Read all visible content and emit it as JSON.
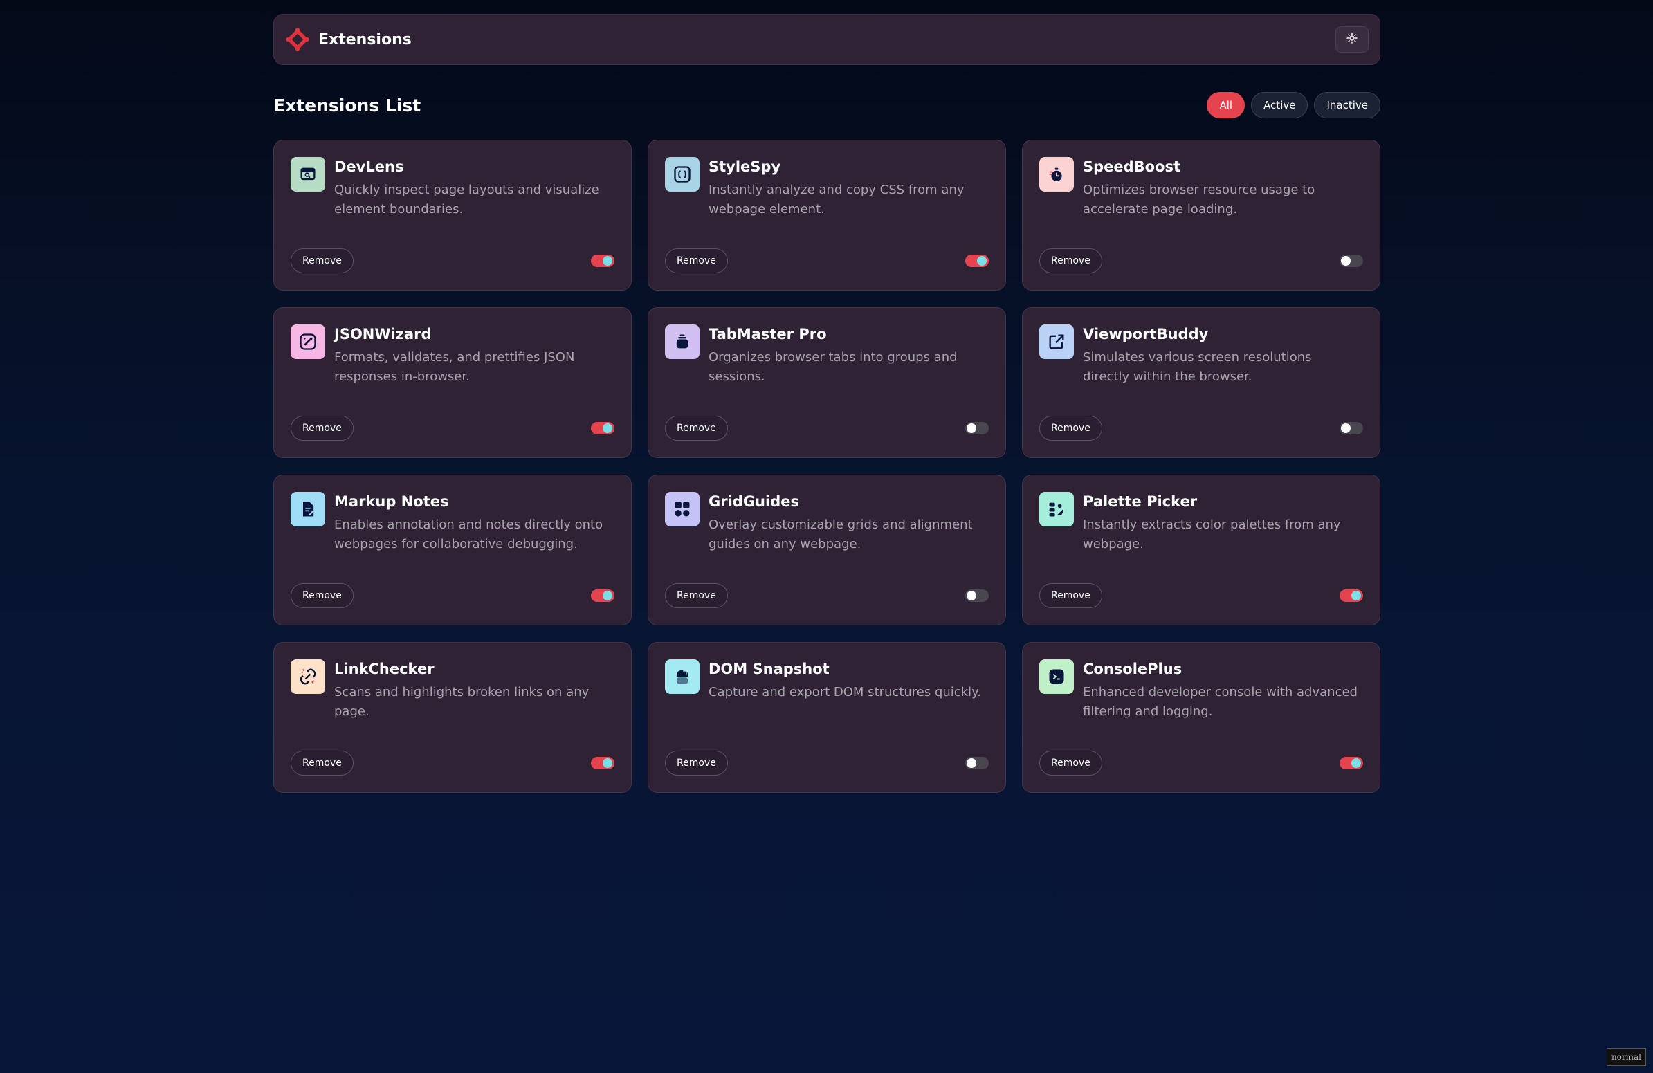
{
  "header": {
    "app_name": "Extensions",
    "theme_icon": "sun-icon"
  },
  "list": {
    "title": "Extensions List"
  },
  "filters": [
    {
      "label": "All",
      "active": true
    },
    {
      "label": "Active",
      "active": false
    },
    {
      "label": "Inactive",
      "active": false
    }
  ],
  "colors": {
    "accent": "#e5444f",
    "toggle_knob_on": "#7be0e6",
    "card_bg": "#2f2234"
  },
  "extensions": [
    {
      "name": "DevLens",
      "description": "Quickly inspect page layouts and visualize element boundaries.",
      "remove_label": "Remove",
      "enabled": true,
      "icon": "inspect-icon",
      "icon_bg": "#b7dcc5"
    },
    {
      "name": "StyleSpy",
      "description": "Instantly analyze and copy CSS from any webpage element.",
      "remove_label": "Remove",
      "enabled": true,
      "icon": "css-braces-icon",
      "icon_bg": "#a9d4e6"
    },
    {
      "name": "SpeedBoost",
      "description": "Optimizes browser resource usage to accelerate page loading.",
      "remove_label": "Remove",
      "enabled": false,
      "icon": "stopwatch-icon",
      "icon_bg": "#fcd3d3"
    },
    {
      "name": "JSONWizard",
      "description": "Formats, validates, and prettifies JSON responses in-browser.",
      "remove_label": "Remove",
      "enabled": true,
      "icon": "wand-icon",
      "icon_bg": "#f6b7e4"
    },
    {
      "name": "TabMaster Pro",
      "description": "Organizes browser tabs into groups and sessions.",
      "remove_label": "Remove",
      "enabled": false,
      "icon": "tabs-icon",
      "icon_bg": "#d0bff0"
    },
    {
      "name": "ViewportBuddy",
      "description": "Simulates various screen resolutions directly within the browser.",
      "remove_label": "Remove",
      "enabled": false,
      "icon": "viewport-icon",
      "icon_bg": "#b9d2f6"
    },
    {
      "name": "Markup Notes",
      "description": "Enables annotation and notes directly onto webpages for collaborative debugging.",
      "remove_label": "Remove",
      "enabled": true,
      "icon": "note-icon",
      "icon_bg": "#9fdcf5"
    },
    {
      "name": "GridGuides",
      "description": "Overlay customizable grids and alignment guides on any webpage.",
      "remove_label": "Remove",
      "enabled": false,
      "icon": "grid-icon",
      "icon_bg": "#c4c2f6"
    },
    {
      "name": "Palette Picker",
      "description": "Instantly extracts color palettes from any webpage.",
      "remove_label": "Remove",
      "enabled": true,
      "icon": "palette-icon",
      "icon_bg": "#a6eedc"
    },
    {
      "name": "LinkChecker",
      "description": "Scans and highlights broken links on any page.",
      "remove_label": "Remove",
      "enabled": true,
      "icon": "link-icon",
      "icon_bg": "#fde1c9"
    },
    {
      "name": "DOM Snapshot",
      "description": "Capture and export DOM structures quickly.",
      "remove_label": "Remove",
      "enabled": false,
      "icon": "snapshot-icon",
      "icon_bg": "#a3eaf3"
    },
    {
      "name": "ConsolePlus",
      "description": "Enhanced developer console with advanced filtering and logging.",
      "remove_label": "Remove",
      "enabled": true,
      "icon": "terminal-icon",
      "icon_bg": "#bff0c7"
    }
  ],
  "mode_badge": "normal"
}
